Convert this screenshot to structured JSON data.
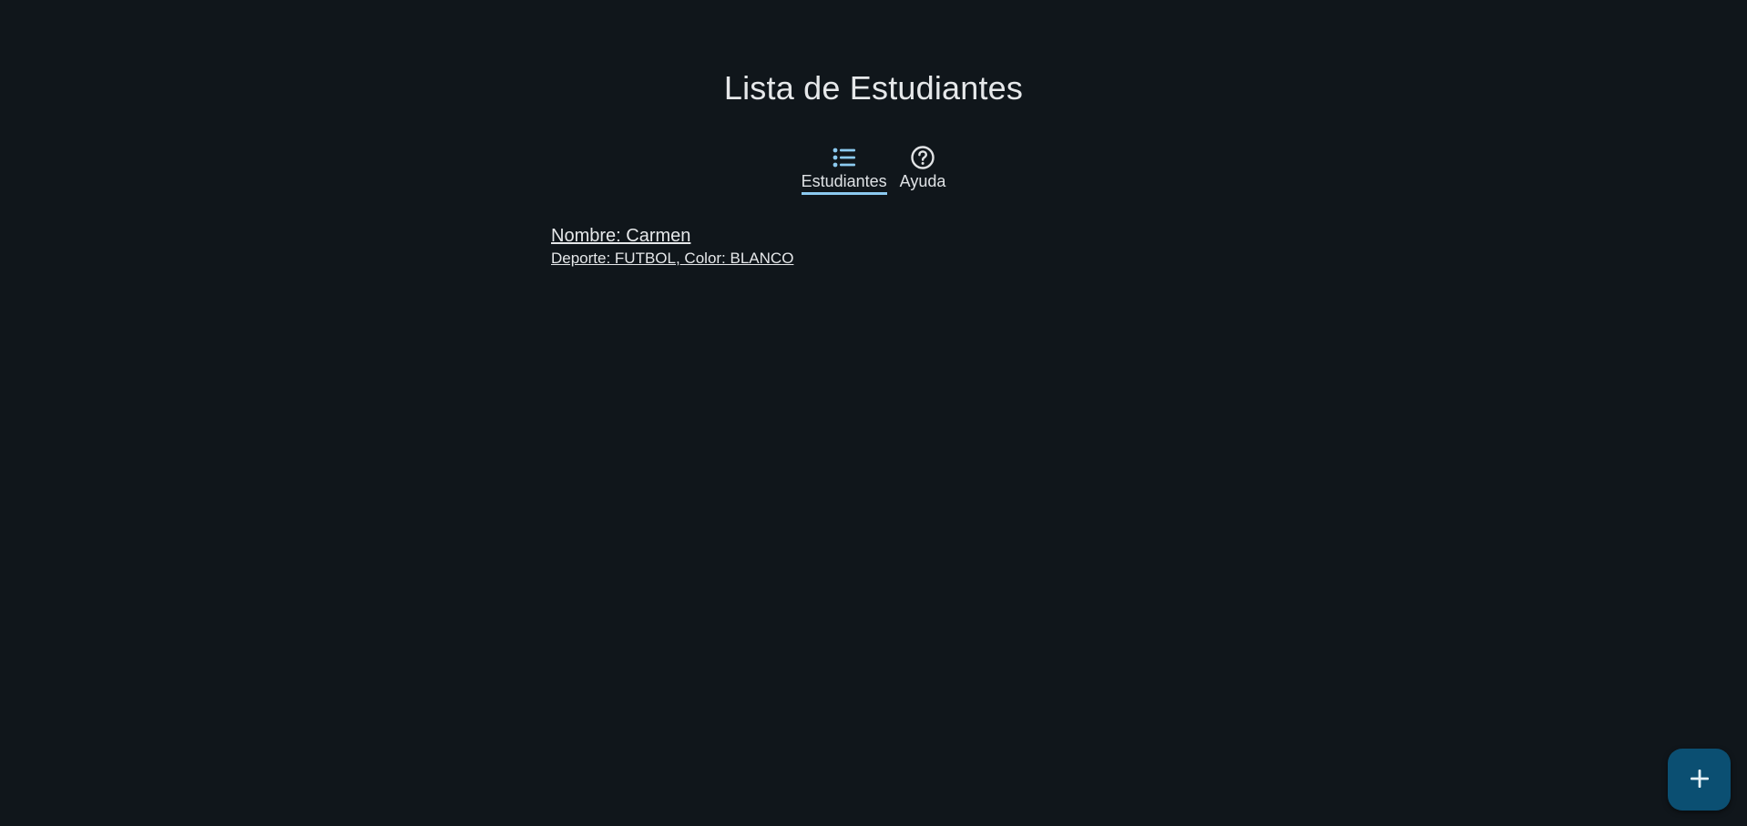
{
  "header": {
    "title": "Lista de Estudiantes"
  },
  "tabs": [
    {
      "label": "Estudiantes",
      "icon": "list-icon",
      "active": true
    },
    {
      "label": "Ayuda",
      "icon": "help-circle-icon",
      "active": false
    }
  ],
  "students": [
    {
      "name": "Nombre: Carmen",
      "details": "Deporte: FUTBOL, Color: BLANCO"
    }
  ],
  "fab": {
    "icon": "plus-icon"
  },
  "colors": {
    "background": "#10161b",
    "accent": "#8ccaf0",
    "fab_background": "#0b4f72",
    "text": "#e6e8ea"
  }
}
